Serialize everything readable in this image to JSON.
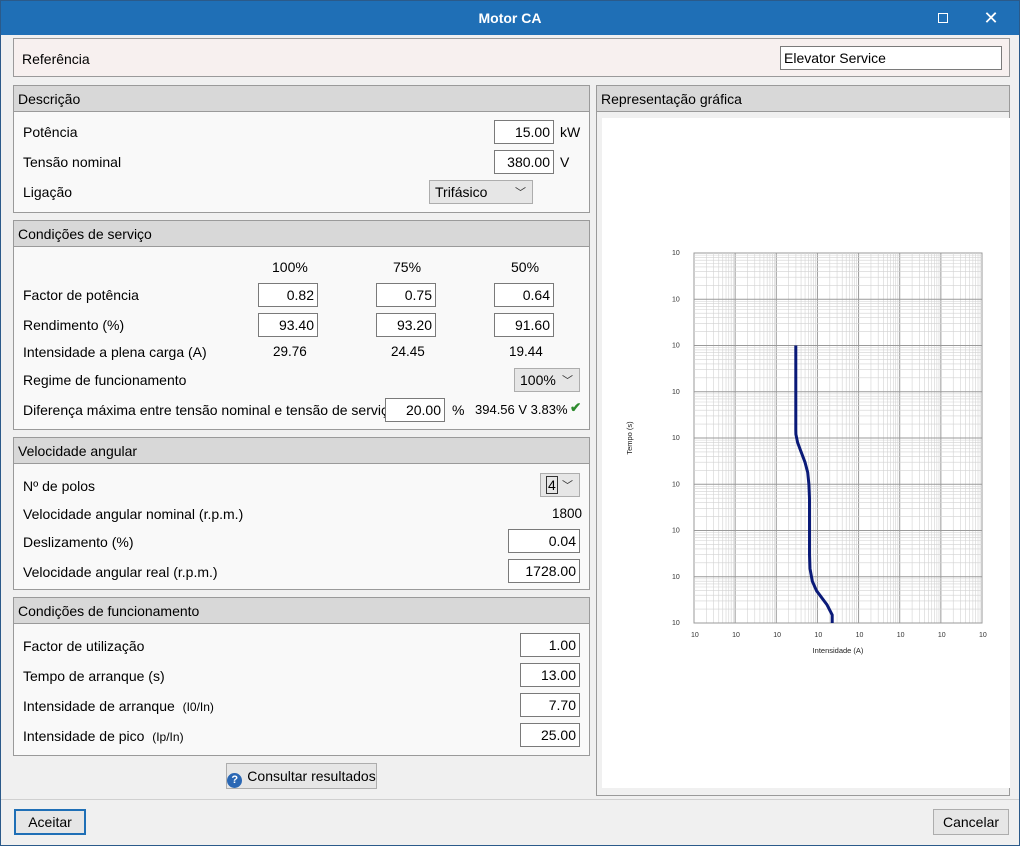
{
  "window": {
    "title": "Motor CA",
    "maximize_icon": "maximize-icon",
    "close_icon": "close-icon",
    "close_glyph": "✕"
  },
  "reference": {
    "label": "Referência",
    "value": "Elevator Service"
  },
  "descricao": {
    "title": "Descrição",
    "potencia": {
      "label": "Potência",
      "value": "15.00",
      "unit": "kW"
    },
    "tensao": {
      "label": "Tensão nominal",
      "value": "380.00",
      "unit": "V"
    },
    "ligacao": {
      "label": "Ligação",
      "value": "Trifásico"
    }
  },
  "servico": {
    "title": "Condições de serviço",
    "columns": [
      "100%",
      "75%",
      "50%"
    ],
    "factor": {
      "label": "Factor de potência",
      "values": [
        "0.82",
        "0.75",
        "0.64"
      ]
    },
    "rendimento": {
      "label": "Rendimento (%)",
      "values": [
        "93.40",
        "93.20",
        "91.60"
      ]
    },
    "intensidade": {
      "label": "Intensidade a plena carga (A)",
      "values": [
        "29.76",
        "24.45",
        "19.44"
      ]
    },
    "regime": {
      "label": "Regime de funcionamento",
      "value": "100%"
    },
    "diferenca": {
      "label": "Diferença máxima entre tensão nominal e tensão de serviço",
      "value": "20.00",
      "unit": "%",
      "result": "394.56 V 3.83%",
      "status_icon": "check-icon",
      "check_glyph": "✔"
    }
  },
  "velocidade": {
    "title": "Velocidade angular",
    "polos": {
      "label": "Nº de polos",
      "value": "4"
    },
    "nominal": {
      "label": "Velocidade angular nominal (r.p.m.)",
      "value": "1800"
    },
    "deslizamento": {
      "label": "Deslizamento (%)",
      "value": "0.04"
    },
    "real": {
      "label": "Velocidade angular real (r.p.m.)",
      "value": "1728.00"
    }
  },
  "funcionamento": {
    "title": "Condições de funcionamento",
    "utilizacao": {
      "label": "Factor de utilização",
      "value": "1.00"
    },
    "tempo": {
      "label": "Tempo de arranque (s)",
      "value": "13.00"
    },
    "arranque": {
      "label": "Intensidade de arranque",
      "sub": "(I0/In)",
      "value": "7.70"
    },
    "pico": {
      "label": "Intensidade de pico",
      "sub": "(Ip/In)",
      "value": "25.00"
    }
  },
  "consultar_button": {
    "label": "Consultar resultados",
    "icon": "help-icon",
    "glyph": "?"
  },
  "grafica": {
    "title": "Representação gráfica"
  },
  "chart_data": {
    "type": "line",
    "xlabel": "Intensidade (A)",
    "ylabel": "Tempo (s)",
    "x_scale": "log",
    "y_scale": "log",
    "x_tick_labels": [
      "10",
      "10",
      "10",
      "10",
      "10",
      "10",
      "10",
      "10"
    ],
    "y_tick_labels": [
      "10",
      "10",
      "10",
      "10",
      "10",
      "10",
      "10",
      "10",
      "10"
    ],
    "grid": true,
    "series": [
      {
        "color": "#0a1a78",
        "x": [
          29.76,
          29.76,
          30,
          33,
          40,
          50,
          58,
          62,
          64,
          64,
          64,
          66,
          75,
          95,
          170,
          229,
          229
        ],
        "y": [
          10000,
          150,
          120,
          80,
          50,
          30,
          18,
          10,
          5,
          1,
          0.3,
          0.15,
          0.08,
          0.05,
          0.025,
          0.015,
          0.01
        ]
      }
    ]
  },
  "footer": {
    "accept": "Aceitar",
    "cancel": "Cancelar"
  }
}
